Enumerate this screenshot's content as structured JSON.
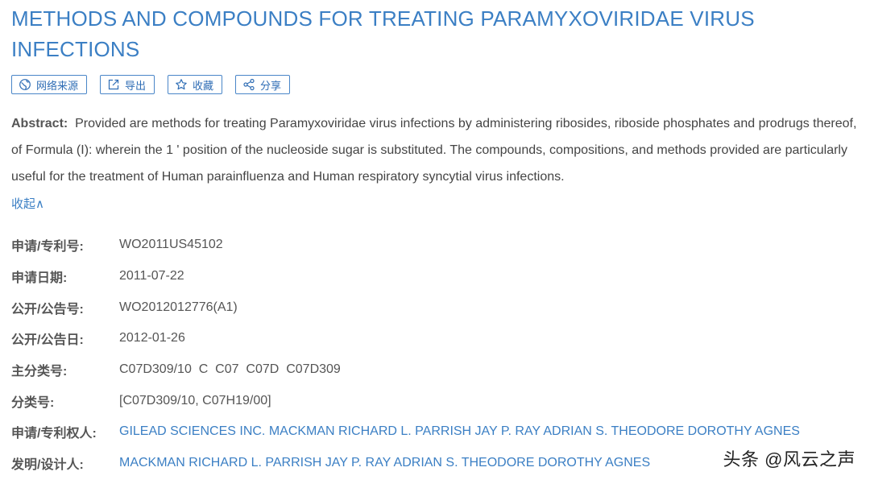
{
  "title": "METHODS AND COMPOUNDS FOR TREATING PARAMYXOVIRIDAE VIRUS INFECTIONS",
  "actions": [
    {
      "label": "网络来源",
      "icon": "globe-icon"
    },
    {
      "label": "导出",
      "icon": "export-icon"
    },
    {
      "label": "收藏",
      "icon": "star-icon"
    },
    {
      "label": "分享",
      "icon": "share-icon"
    }
  ],
  "abstract": {
    "label": "Abstract:",
    "text": "Provided are methods for treating Paramyxoviridae virus infections by administering ribosides, riboside phosphates and prodrugs thereof, of Formula (I): wherein the 1 ' position of the nucleoside sugar is substituted. The compounds, compositions, and methods provided are particularly useful for the treatment of Human parainfluenza and Human respiratory syncytial virus infections."
  },
  "collapse_label": "收起∧",
  "fields": [
    {
      "label": "申请/专利号:",
      "value": "WO2011US45102"
    },
    {
      "label": "申请日期:",
      "value": "2011-07-22"
    },
    {
      "label": "公开/公告号:",
      "value": "WO2012012776(A1)"
    },
    {
      "label": "公开/公告日:",
      "value": "2012-01-26"
    },
    {
      "label": "主分类号:",
      "value": "C07D309/10  C  C07  C07D  C07D309"
    },
    {
      "label": "分类号:",
      "value": "[C07D309/10, C07H19/00]"
    },
    {
      "label": "申请/专利权人:",
      "value": "GILEAD SCIENCES INC. MACKMAN RICHARD L. PARRISH JAY P. RAY ADRIAN S. THEODORE DOROTHY AGNES"
    },
    {
      "label": "发明/设计人:",
      "value": "MACKMAN RICHARD L. PARRISH JAY P. RAY ADRIAN S. THEODORE DOROTHY AGNES"
    }
  ],
  "watermark": "头条 @风云之声",
  "colors": {
    "title": "#3b7fc4",
    "link": "#3b7fc4",
    "label": "#555555",
    "text": "#444444"
  }
}
